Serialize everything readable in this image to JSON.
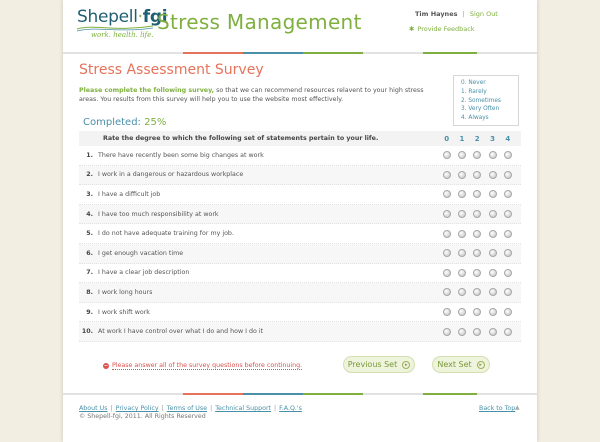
{
  "header": {
    "logo_text_left": "Shepell",
    "logo_text_dot": "·",
    "logo_text_right": "fgi",
    "tagline": "work. health. life.",
    "app_title": "Stress Management",
    "user_name": "Tim Haynes",
    "sign_out": "Sign Out",
    "feedback": "Provide Feedback"
  },
  "survey": {
    "title": "Stress Assessment Survey",
    "intro_highlight": "Please complete the following survey,",
    "intro_rest": " so that we can recommend resources relavent to your high stress areas. You results from this survey will help you to use the website most effectively.",
    "completed_label": "Completed:",
    "completed_value": "25%",
    "legend": [
      "0.  Never",
      "1.  Rarely",
      "2.  Sometimes",
      "3.  Very Often",
      "4.  Always"
    ],
    "table_header": "Rate the degree to which the following set of statements pertain to your life.",
    "scale": [
      "0",
      "1",
      "2",
      "3",
      "4"
    ],
    "questions": [
      {
        "num": "1.",
        "text": "There have recently been some big changes at work"
      },
      {
        "num": "2.",
        "text": "I work in a dangerous or hazardous workplace"
      },
      {
        "num": "3.",
        "text": "I have a difficult job"
      },
      {
        "num": "4.",
        "text": "I have too much responsibility at work"
      },
      {
        "num": "5.",
        "text": "I do not have adequate training for my job."
      },
      {
        "num": "6.",
        "text": "I get enough vacation time"
      },
      {
        "num": "7.",
        "text": "I have a clear job description"
      },
      {
        "num": "8.",
        "text": "I work long hours"
      },
      {
        "num": "9.",
        "text": "I work shift work"
      },
      {
        "num": "10.",
        "text": "At work I have control over what I do and how I do it"
      }
    ],
    "error_message": "Please answer all of the survey questions before continuing.",
    "prev_label": "Previous Set",
    "next_label": "Next Set"
  },
  "footer": {
    "links": [
      "About Us",
      "Privacy Policy",
      "Terms of Use",
      "Technical Support",
      "F.A.Q.'s"
    ],
    "copyright": "© Shepell-fgi, 2011.  All Rights Reserved",
    "back_to_top": "Back to Top"
  },
  "colors": {
    "accent_green": "#7fb03f",
    "title_orange": "#e5735b",
    "link_blue": "#4a90a8",
    "error_red": "#d9534f"
  }
}
